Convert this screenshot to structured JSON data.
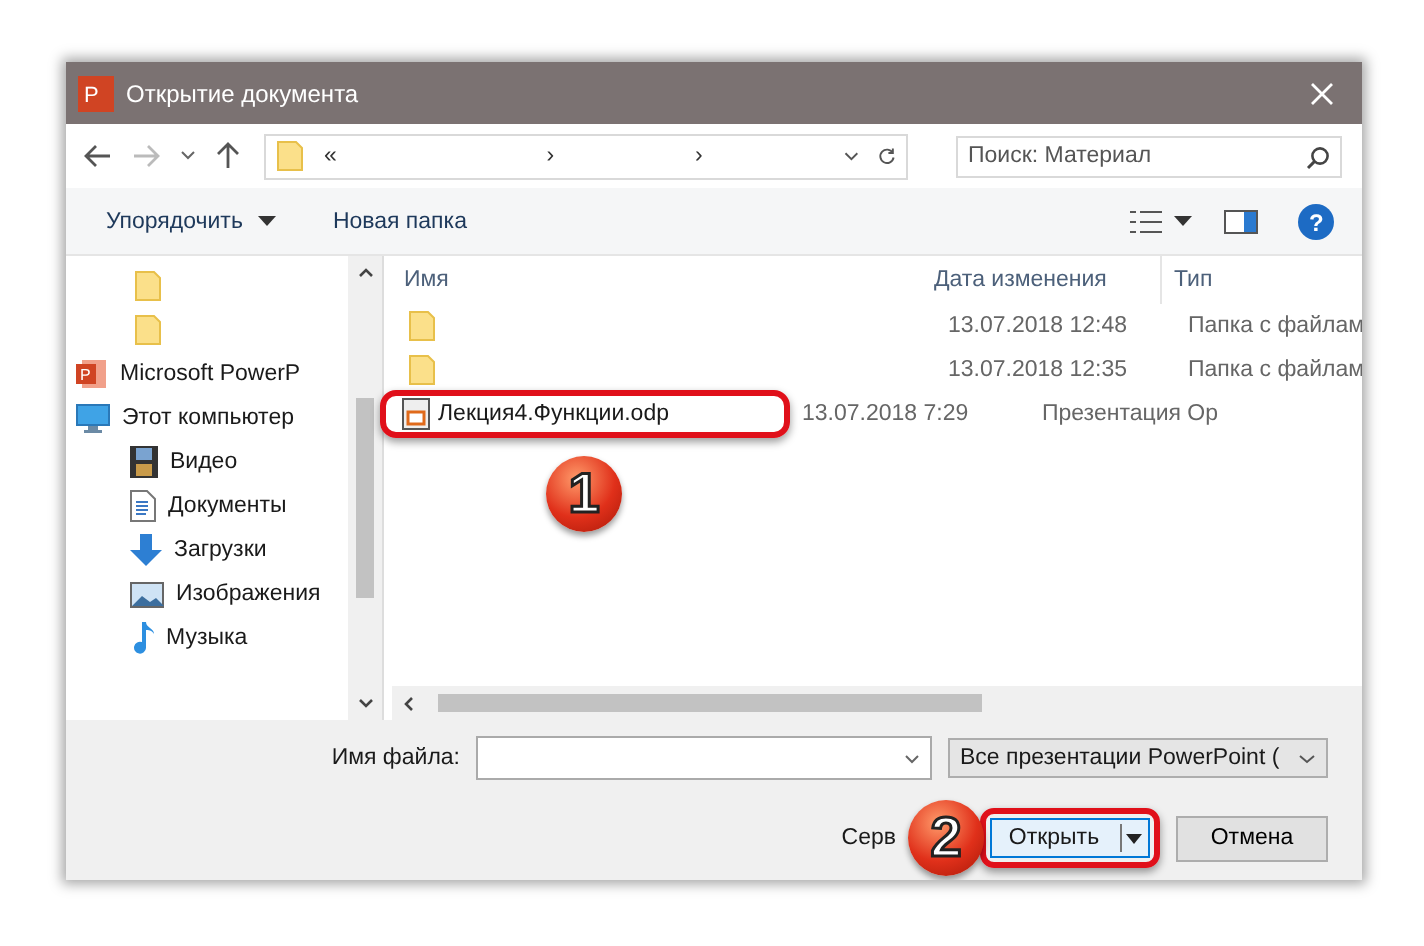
{
  "window": {
    "title": "Открытие документа",
    "app_icon_letter": "P"
  },
  "help_icon": "?",
  "nav": {
    "crumbs": [
      "«",
      "›",
      "›"
    ],
    "search_placeholder": "Поиск: Материал"
  },
  "toolbar": {
    "organize": "Упорядочить",
    "new_folder": "Новая папка"
  },
  "sidebar": {
    "items": [
      {
        "kind": "folder"
      },
      {
        "kind": "folder"
      },
      {
        "kind": "app",
        "label": "Microsoft PowerP",
        "icon_letter": "P"
      },
      {
        "kind": "computer",
        "label": "Этот компьютер",
        "children": [
          {
            "kind": "video",
            "label": "Видео"
          },
          {
            "kind": "documents",
            "label": "Документы"
          },
          {
            "kind": "downloads",
            "label": "Загрузки"
          },
          {
            "kind": "pictures",
            "label": "Изображения"
          },
          {
            "kind": "music",
            "label": "Музыка"
          }
        ]
      }
    ]
  },
  "table": {
    "columns": [
      "Имя",
      "Дата изменения",
      "Тип"
    ],
    "rows": [
      {
        "kind": "folder",
        "date": "13.07.2018 12:48",
        "type": "Папка с файлам",
        "highlighted": false
      },
      {
        "kind": "folder",
        "date": "13.07.2018 12:35",
        "type": "Папка с файлам",
        "highlighted": false
      },
      {
        "kind": "presentation",
        "name": "Лекция4.Функции.odp",
        "date": "13.07.2018 7:29",
        "type": "Презентация Ор",
        "highlighted": true
      }
    ]
  },
  "footer": {
    "filename_label": "Имя файла:",
    "filter": "Все презентации PowerPoint (",
    "tools": "Серв",
    "open": "Открыть",
    "cancel": "Отмена"
  },
  "callouts": [
    "1",
    "2"
  ]
}
